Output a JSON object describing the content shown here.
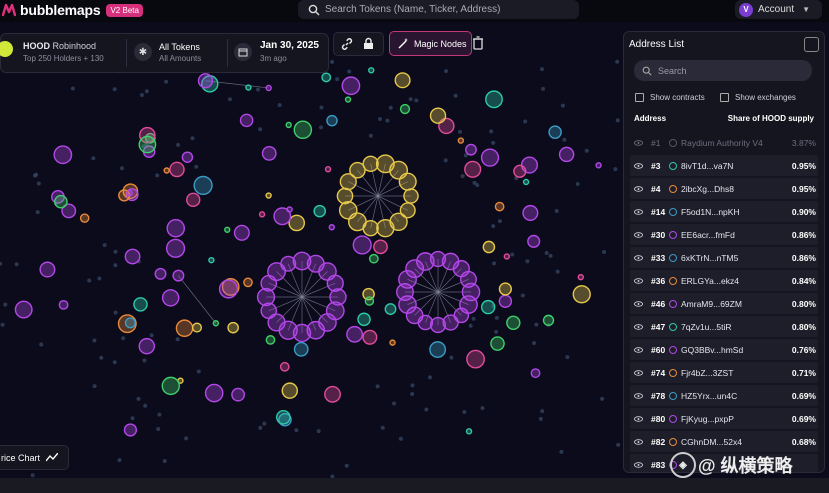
{
  "app": {
    "name": "bubblemaps",
    "badge": "V2 Beta"
  },
  "search": {
    "placeholder": "Search Tokens (Name, Ticker, Address)"
  },
  "account": {
    "avatar": "V",
    "label": "Account"
  },
  "token": {
    "ticker": "HOOD",
    "name": "Robinhood",
    "holders": "Top 250 Holders + 130"
  },
  "filter": {
    "title": "All Tokens",
    "subtitle": "All Amounts"
  },
  "date": {
    "value": "Jan 30, 2025",
    "ago": "3m ago"
  },
  "toolbar": {
    "magic_label": "Magic Nodes"
  },
  "panel": {
    "title": "Address List",
    "search_placeholder": "Search",
    "show_contracts": "Show contracts",
    "show_exchanges": "Show exchanges",
    "col_address": "Address",
    "col_share": "Share of HOOD supply",
    "rows": [
      {
        "rank": "#1",
        "addr": "Raydium Authority V4",
        "share": "3.87%",
        "color": "#555566",
        "dim": true
      },
      {
        "rank": "#3",
        "addr": "8ivT1d...va7N",
        "share": "0.95%",
        "color": "#2ec9a8"
      },
      {
        "rank": "#4",
        "addr": "2ibcXg...Dhs8",
        "share": "0.95%",
        "color": "#e88a3a"
      },
      {
        "rank": "#14",
        "addr": "F5od1N...npKH",
        "share": "0.90%",
        "color": "#3a9cc4"
      },
      {
        "rank": "#30",
        "addr": "EE6acr...fmFd",
        "share": "0.86%",
        "color": "#b347e8"
      },
      {
        "rank": "#33",
        "addr": "6xKTrN...nTM5",
        "share": "0.86%",
        "color": "#3a9cc4"
      },
      {
        "rank": "#36",
        "addr": "ERLGYa...ekz4",
        "share": "0.84%",
        "color": "#e88a3a"
      },
      {
        "rank": "#46",
        "addr": "AmraM9...69ZM",
        "share": "0.80%",
        "color": "#b347e8"
      },
      {
        "rank": "#47",
        "addr": "7qZv1u...5tiR",
        "share": "0.80%",
        "color": "#2ec9a8"
      },
      {
        "rank": "#60",
        "addr": "GQ3BBv...hmSd",
        "share": "0.76%",
        "color": "#b347e8"
      },
      {
        "rank": "#74",
        "addr": "Fjr4bZ...3ZST",
        "share": "0.71%",
        "color": "#e88a3a"
      },
      {
        "rank": "#78",
        "addr": "HZ5Yrx...un4C",
        "share": "0.69%",
        "color": "#3a9cc4"
      },
      {
        "rank": "#80",
        "addr": "FjKyug...pxpP",
        "share": "0.69%",
        "color": "#b347e8"
      },
      {
        "rank": "#82",
        "addr": "CGhnDM...52x4",
        "share": "0.68%",
        "color": "#e88a3a"
      },
      {
        "rank": "#83",
        "addr": "",
        "share": "",
        "color": "#b347e8"
      }
    ]
  },
  "price_chart": {
    "label": "rice Chart"
  },
  "watermark": {
    "text": "@ 纵横策略"
  },
  "colors": {
    "purple": "#b347e8",
    "yellow": "#e6c84a",
    "teal": "#2ec9a8",
    "blue": "#3a9cc4",
    "orange": "#e88a3a",
    "pink": "#e04b9b",
    "green": "#3fcf6a",
    "accent": "#d6307c"
  }
}
